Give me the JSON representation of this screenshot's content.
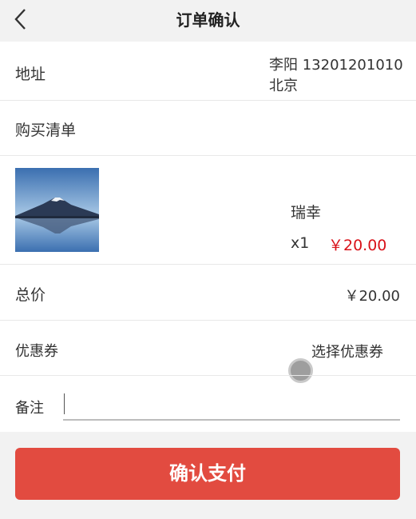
{
  "header": {
    "back_icon": "chevron-left-icon",
    "title": "订单确认"
  },
  "address": {
    "label": "地址",
    "name_phone": "李阳 13201201010",
    "city": "北京"
  },
  "list": {
    "label": "购买清单"
  },
  "product": {
    "image_icon": "mountain-lake-photo",
    "name": "瑞幸",
    "quantity": "x1",
    "price": "￥20.00",
    "price_color": "#d9121a"
  },
  "total": {
    "label": "总价",
    "value": "￥20.00"
  },
  "coupon": {
    "label": "优惠券",
    "action": "选择优惠券"
  },
  "note": {
    "label": "备注",
    "value": "",
    "placeholder": ""
  },
  "pay": {
    "label": "确认支付",
    "color": "#e24b40"
  }
}
